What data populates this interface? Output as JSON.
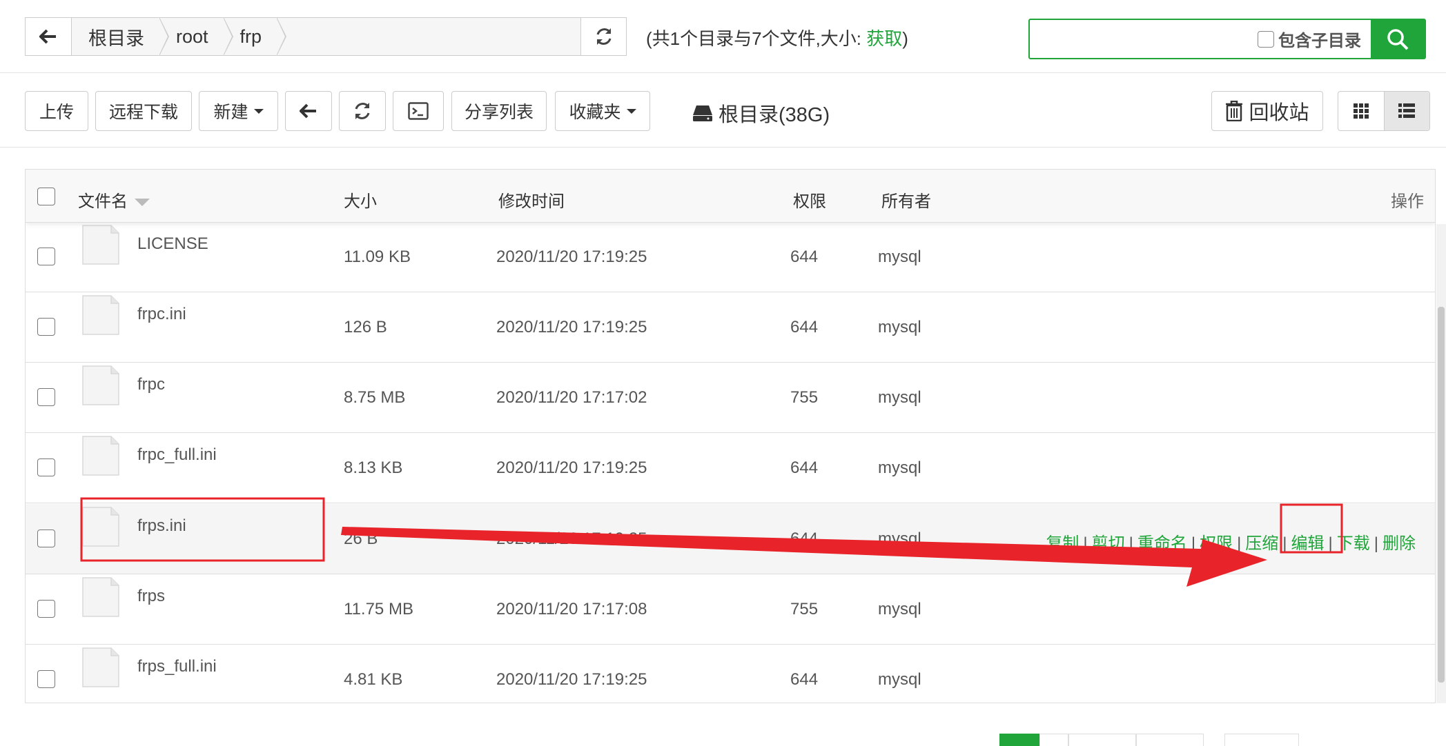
{
  "breadcrumb": [
    "根目录",
    "root",
    "frp"
  ],
  "summary": {
    "text": "(共1个目录与7个文件,大小: ",
    "link": "获取",
    "close": ")"
  },
  "search": {
    "subdir_label": "包含子目录",
    "placeholder": ""
  },
  "toolbar": {
    "upload": "上传",
    "remote_download": "远程下载",
    "new": "新建",
    "share_list": "分享列表",
    "favorites": "收藏夹",
    "disk": "根目录(38G)",
    "recycle": "回收站"
  },
  "columns": {
    "name": "文件名",
    "size": "大小",
    "mtime": "修改时间",
    "perm": "权限",
    "owner": "所有者",
    "actions": "操作"
  },
  "files": [
    {
      "name": "LICENSE",
      "size": "11.09 KB",
      "mtime": "2020/11/20 17:19:25",
      "perm": "644",
      "owner": "mysql"
    },
    {
      "name": "frpc.ini",
      "size": "126 B",
      "mtime": "2020/11/20 17:19:25",
      "perm": "644",
      "owner": "mysql"
    },
    {
      "name": "frpc",
      "size": "8.75 MB",
      "mtime": "2020/11/20 17:17:02",
      "perm": "755",
      "owner": "mysql"
    },
    {
      "name": "frpc_full.ini",
      "size": "8.13 KB",
      "mtime": "2020/11/20 17:19:25",
      "perm": "644",
      "owner": "mysql"
    },
    {
      "name": "frps.ini",
      "size": "26 B",
      "mtime": "2020/11/20 17:19:25",
      "perm": "644",
      "owner": "mysql"
    },
    {
      "name": "frps",
      "size": "11.75 MB",
      "mtime": "2020/11/20 17:17:08",
      "perm": "755",
      "owner": "mysql"
    },
    {
      "name": "frps_full.ini",
      "size": "4.81 KB",
      "mtime": "2020/11/20 17:19:25",
      "perm": "644",
      "owner": "mysql"
    }
  ],
  "row_actions": {
    "copy": "复制",
    "cut": "剪切",
    "rename": "重命名",
    "perm": "权限",
    "compress": "压缩",
    "edit": "编辑",
    "download": "下载",
    "delete": "删除"
  },
  "colors": {
    "accent": "#20a53a",
    "annotation": "#e8232a"
  }
}
